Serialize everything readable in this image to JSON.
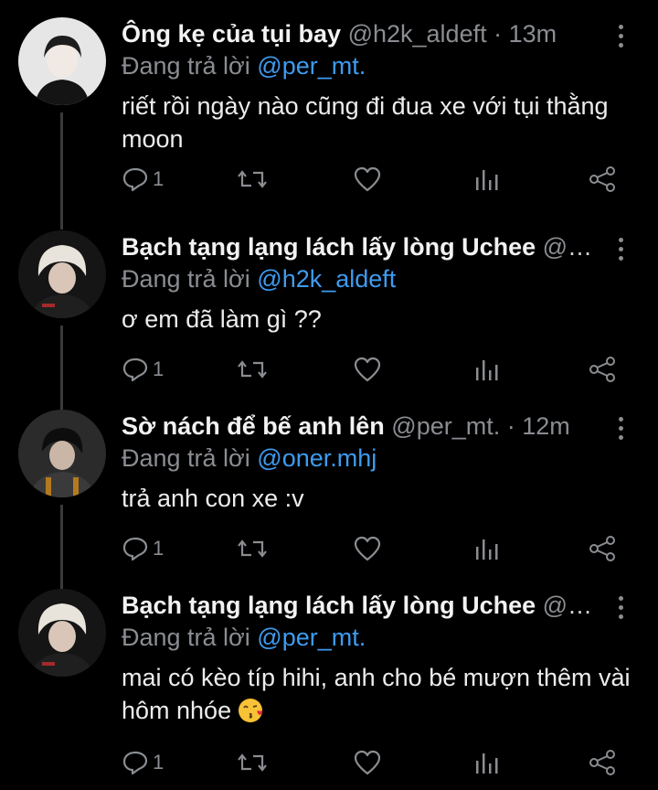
{
  "tweets": [
    {
      "name": "Ông kẹ của tụi bay",
      "meta": "@h2k_aldeft · 13m",
      "reply_prefix": "Đang trả lời",
      "reply_to": "@per_mt.",
      "text": "riết rồi ngày nào cũng đi đua xe với tụi thằng moon",
      "reply_count": "1"
    },
    {
      "name": "Bạch tạng lạng lách lấy lòng Uchee",
      "meta": "@o...",
      "reply_prefix": "Đang trả lời",
      "reply_to": "@h2k_aldeft",
      "text": "ơ em đã làm gì ??",
      "reply_count": "1"
    },
    {
      "name": "Sờ nách để bế anh lên",
      "meta": "@per_mt. · 12m",
      "reply_prefix": "Đang trả lời",
      "reply_to": "@oner.mhj",
      "text": "trả anh con xe :v",
      "reply_count": "1"
    },
    {
      "name": "Bạch tạng lạng lách lấy lòng Uchee",
      "meta": "@o...",
      "reply_prefix": "Đang trả lời",
      "reply_to": "@per_mt.",
      "text": "mai có kèo típ hihi, anh cho bé mượn thêm vài hôm nhóe",
      "reply_count": "1",
      "emoji": "kissing-face-emoji"
    }
  ],
  "icons": {
    "reply": "reply-icon",
    "retweet": "retweet-icon",
    "like": "heart-icon",
    "stats": "analytics-icon",
    "share": "share-icon",
    "more": "more-icon"
  },
  "colors": {
    "background": "#000000",
    "mention": "#3e9bf0",
    "muted": "#8a8d91",
    "text": "#ececec"
  }
}
